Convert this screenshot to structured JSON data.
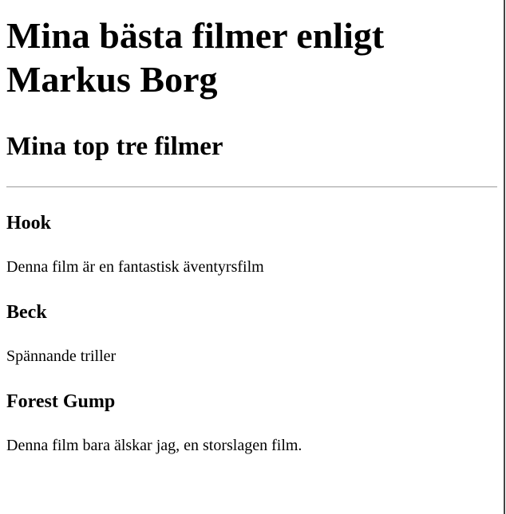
{
  "page": {
    "title": "Mina bästa filmer enligt Markus Borg",
    "subtitle": "Mina top tre filmer"
  },
  "movies": [
    {
      "title": "Hook",
      "description": "Denna film är en fantastisk äventyrsfilm"
    },
    {
      "title": "Beck",
      "description": "Spännande triller"
    },
    {
      "title": "Forest Gump",
      "description": "Denna film bara älskar jag, en storslagen film."
    }
  ],
  "colors": {
    "background": "#ffffff",
    "text": "#000000",
    "divider": "#9a9a9a",
    "window_edge": "#444444"
  }
}
